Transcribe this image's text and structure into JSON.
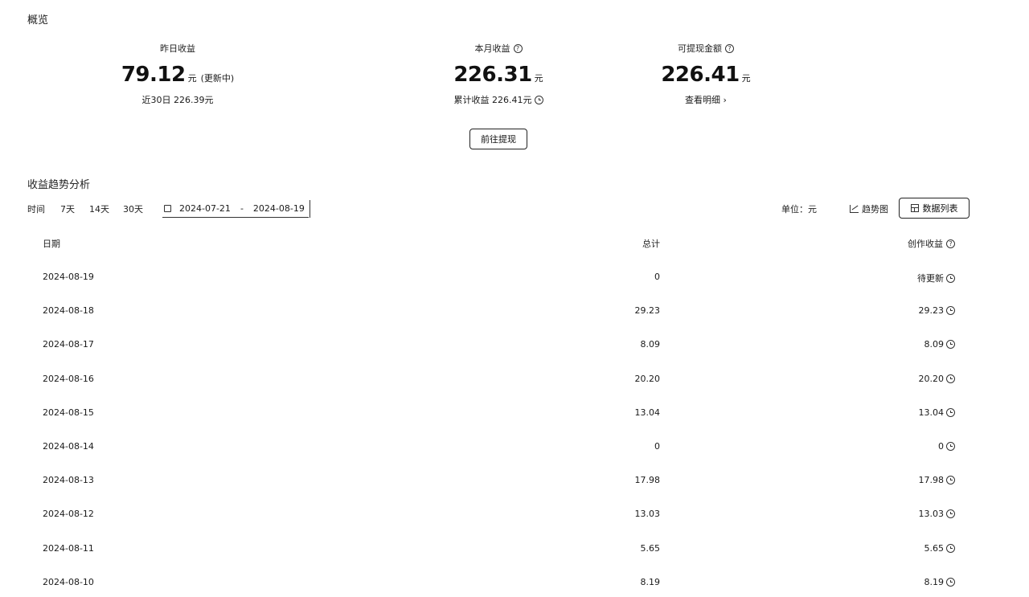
{
  "overview": {
    "title": "概览",
    "yesterday": {
      "label": "昨日收益",
      "value": "79.12",
      "unit": "元",
      "note": "(更新中)",
      "sub": "近30日 226.39元"
    },
    "month": {
      "label": "本月收益",
      "value": "226.31",
      "unit": "元",
      "sub": "累计收益 226.41元"
    },
    "withdrawable": {
      "label": "可提现金额",
      "value": "226.41",
      "unit": "元",
      "sub": "查看明细 ›"
    },
    "withdraw_button": "前往提现"
  },
  "trend": {
    "title": "收益趋势分析",
    "time_label": "时间",
    "ranges": [
      "7天",
      "14天",
      "30天"
    ],
    "date_start": "2024-07-21",
    "date_sep": "-",
    "date_end": "2024-08-19",
    "unit_label": "单位：元",
    "chart_view_label": "趋势图",
    "table_view_label": "数据列表"
  },
  "table": {
    "headers": {
      "date": "日期",
      "total": "总计",
      "creation": "创作收益"
    },
    "rows": [
      {
        "date": "2024-08-19",
        "total": "0",
        "creation": "待更新"
      },
      {
        "date": "2024-08-18",
        "total": "29.23",
        "creation": "29.23"
      },
      {
        "date": "2024-08-17",
        "total": "8.09",
        "creation": "8.09"
      },
      {
        "date": "2024-08-16",
        "total": "20.20",
        "creation": "20.20"
      },
      {
        "date": "2024-08-15",
        "total": "13.04",
        "creation": "13.04"
      },
      {
        "date": "2024-08-14",
        "total": "0",
        "creation": "0"
      },
      {
        "date": "2024-08-13",
        "total": "17.98",
        "creation": "17.98"
      },
      {
        "date": "2024-08-12",
        "total": "13.03",
        "creation": "13.03"
      },
      {
        "date": "2024-08-11",
        "total": "5.65",
        "creation": "5.65"
      },
      {
        "date": "2024-08-10",
        "total": "8.19",
        "creation": "8.19"
      }
    ]
  },
  "icons": {
    "help": "question-circle-icon",
    "clock": "clock-icon",
    "calendar": "calendar-icon",
    "trend": "line-chart-icon",
    "table": "table-icon"
  }
}
